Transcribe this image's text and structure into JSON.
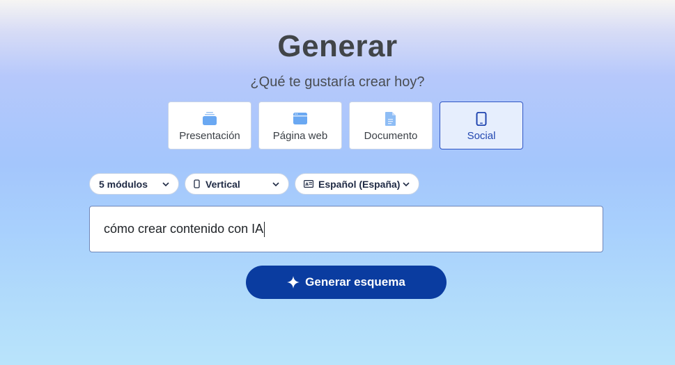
{
  "page": {
    "title": "Generar",
    "subtitle": "¿Qué te gustaría crear hoy?"
  },
  "content_types": [
    {
      "label": "Presentación",
      "icon": "presentation-icon",
      "selected": false
    },
    {
      "label": "Página web",
      "icon": "webpage-icon",
      "selected": false
    },
    {
      "label": "Documento",
      "icon": "document-icon",
      "selected": false
    },
    {
      "label": "Social",
      "icon": "mobile-phone-icon",
      "selected": true
    }
  ],
  "options": {
    "modules": {
      "value": "5 módulos",
      "icon": "chevron-down-icon"
    },
    "orientation": {
      "value": "Vertical",
      "icon": "phone-outline-icon"
    },
    "language": {
      "value": "Español (España)",
      "icon": "language-icon"
    }
  },
  "prompt": {
    "value": "cómo crear contenido con IA"
  },
  "generate_button": {
    "label": "Generar esquema",
    "icon": "sparkle-icon"
  },
  "colors": {
    "accent": "#0a3ca0",
    "selected_bg": "#e6eefd",
    "selected_border": "#2f55c3",
    "icon_blue": "#6aa8f2"
  }
}
